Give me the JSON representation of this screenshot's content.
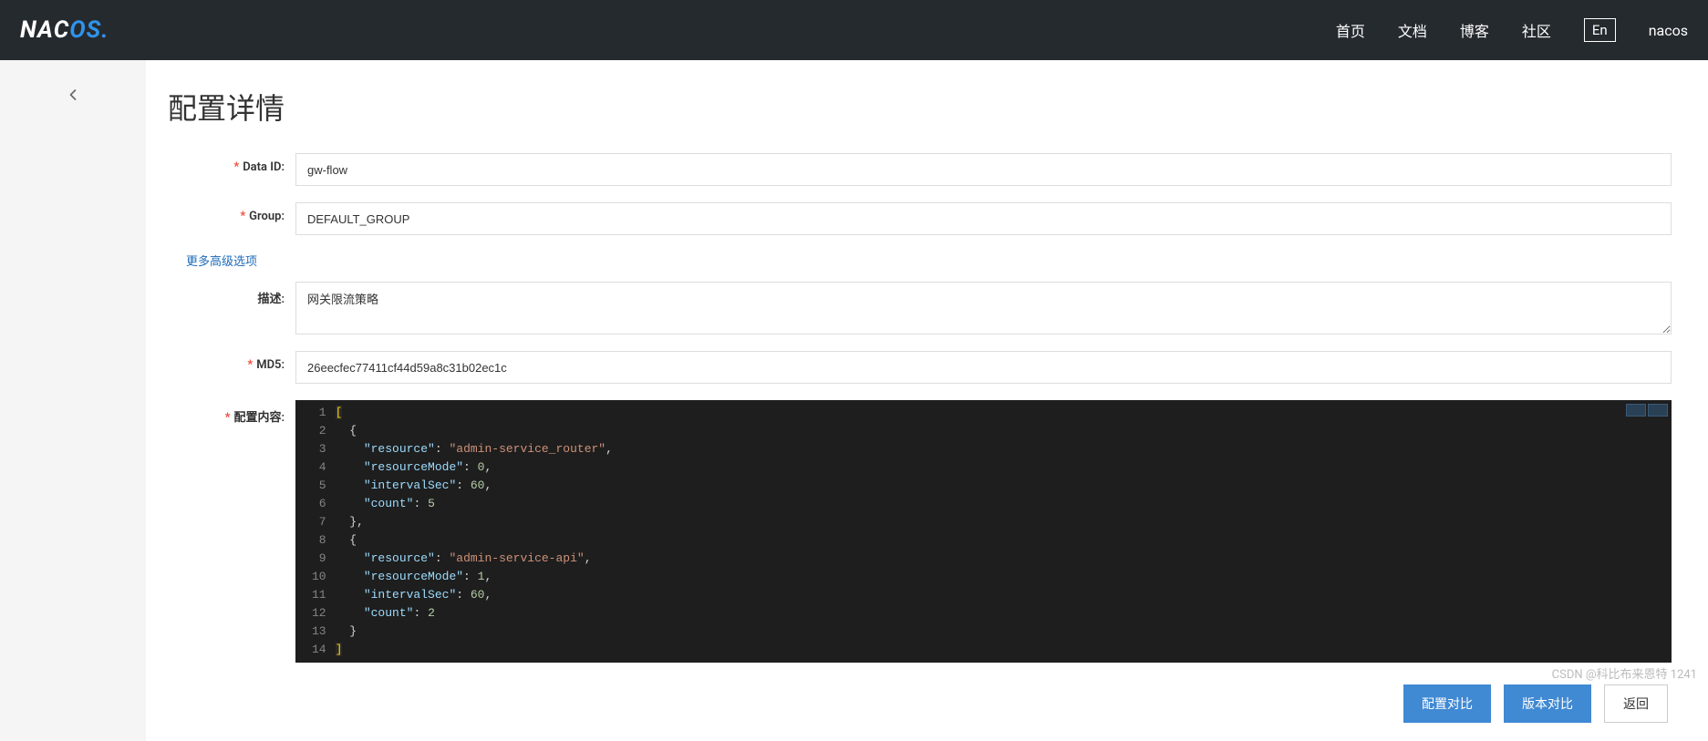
{
  "brand": {
    "text1": "NAC",
    "text2": "OS",
    "dot": "."
  },
  "nav": {
    "home": "首页",
    "docs": "文档",
    "blog": "博客",
    "community": "社区",
    "lang": "En",
    "product": "nacos"
  },
  "page": {
    "title": "配置详情",
    "more_options": "更多高级选项"
  },
  "labels": {
    "data_id": "Data ID:",
    "group": "Group:",
    "description": "描述:",
    "md5": "MD5:",
    "content": "配置内容:"
  },
  "form": {
    "data_id": "gw-flow",
    "group": "DEFAULT_GROUP",
    "description": "网关限流策略",
    "md5": "26eecfec77411cf44d59a8c31b02ec1c"
  },
  "code": {
    "lines": [
      "[",
      "  {",
      "    \"resource\": \"admin-service_router\",",
      "    \"resourceMode\": 0,",
      "    \"intervalSec\": 60,",
      "    \"count\": 5",
      "  },",
      "  {",
      "    \"resource\": \"admin-service-api\",",
      "    \"resourceMode\": 1,",
      "    \"intervalSec\": 60,",
      "    \"count\": 2",
      "  }",
      "]"
    ]
  },
  "buttons": {
    "config_compare": "配置对比",
    "version_compare": "版本对比",
    "back": "返回"
  },
  "watermark": "CSDN @科比布来恩特 1241"
}
